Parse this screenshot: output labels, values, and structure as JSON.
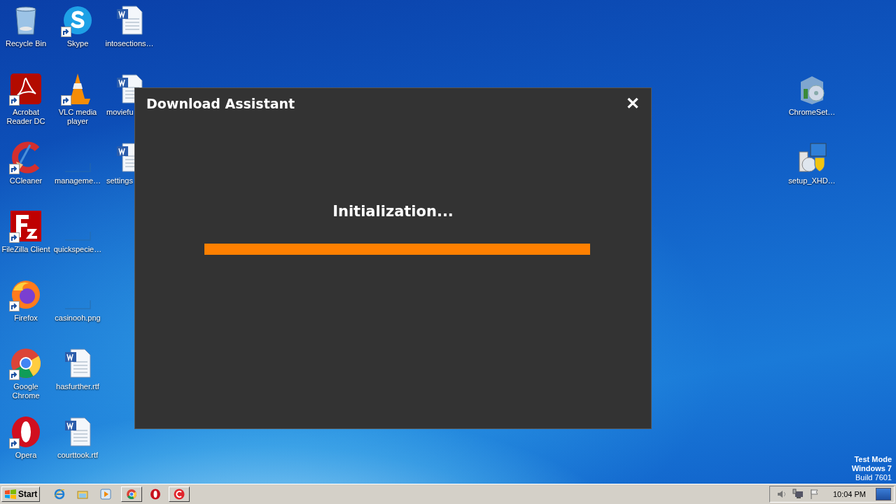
{
  "desktop": {
    "columns": [
      [
        {
          "label": "Recycle Bin",
          "kind": "recycle",
          "shortcut": false
        },
        {
          "label": "Acrobat Reader DC",
          "kind": "acrobat",
          "shortcut": true
        },
        {
          "label": "CCleaner",
          "kind": "ccleaner",
          "shortcut": true
        },
        {
          "label": "FileZilla Client",
          "kind": "filezilla",
          "shortcut": true
        },
        {
          "label": "Firefox",
          "kind": "firefox",
          "shortcut": true
        },
        {
          "label": "Google Chrome",
          "kind": "chrome",
          "shortcut": true
        },
        {
          "label": "Opera",
          "kind": "opera",
          "shortcut": true
        }
      ],
      [
        {
          "label": "Skype",
          "kind": "skype",
          "shortcut": true
        },
        {
          "label": "VLC media player",
          "kind": "vlc",
          "shortcut": true
        },
        {
          "label": "manageme…",
          "kind": "image",
          "shortcut": false
        },
        {
          "label": "quickspecie…",
          "kind": "image",
          "shortcut": false
        },
        {
          "label": "casinooh.png",
          "kind": "image",
          "shortcut": false
        },
        {
          "label": "hasfurther.rtf",
          "kind": "word",
          "shortcut": false
        },
        {
          "label": "courttook.rtf",
          "kind": "word",
          "shortcut": false
        }
      ],
      [
        {
          "label": "intosections…",
          "kind": "word",
          "shortcut": false
        },
        {
          "label": "moviefu",
          "kind": "word",
          "shortcut": false,
          "cut": true
        },
        {
          "label": "settings",
          "kind": "word",
          "shortcut": false,
          "cut": true
        }
      ]
    ],
    "right_column": [
      {
        "label": "ChromeSet…",
        "kind": "installer",
        "shortcut": false
      },
      {
        "label": "setup_XHD…",
        "kind": "setup",
        "shortcut": false
      }
    ],
    "os_notice": [
      "Test Mode",
      "Windows 7",
      "Build 7601"
    ]
  },
  "dialog": {
    "title": "Download Assistant",
    "close": "✕",
    "status": "Initialization...",
    "progress": {
      "level": 1.0
    }
  },
  "taskbar": {
    "start": "Start",
    "quick_launch": [
      {
        "kind": "ie"
      },
      {
        "kind": "explorer"
      },
      {
        "kind": "media"
      }
    ],
    "tasks": [
      {
        "kind": "chrome",
        "selected": false
      },
      {
        "kind": "opera",
        "selected": false
      },
      {
        "kind": "ccleaner",
        "selected": false
      }
    ],
    "tray": [
      {
        "kind": "speaker"
      },
      {
        "kind": "network"
      },
      {
        "kind": "flag"
      }
    ],
    "clock": "10:04 PM"
  }
}
